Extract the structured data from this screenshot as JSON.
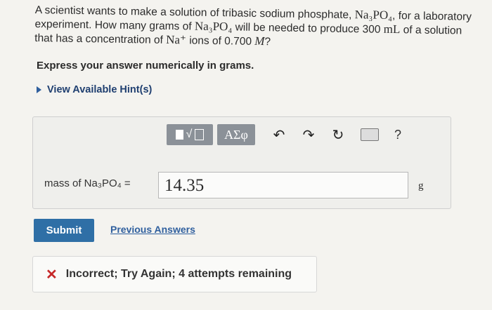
{
  "question": {
    "line1_a": "A scientist wants to make a solution of tribasic sodium phosphate, ",
    "line1_formula": "Na₃PO₄",
    "line1_b": ", for a laboratory",
    "line2_a": "experiment. How many grams of ",
    "line2_formula": "Na₃PO₄",
    "line2_b": " will be needed to produce 300 ",
    "line2_unit": "mL",
    "line2_c": " of a solution",
    "line3_a": "that has a concentration of ",
    "line3_ion": "Na⁺",
    "line3_b": " ions of 0.700 ",
    "line3_M": "M",
    "line3_c": "?"
  },
  "instruction": "Express your answer numerically in grams.",
  "hint_label": "View Available Hint(s)",
  "toolbar": {
    "greek_label": "ΑΣφ",
    "undo_symbol": "↶",
    "redo_symbol": "↷",
    "reset_symbol": "↻",
    "help_symbol": "?"
  },
  "answer": {
    "label": "mass of Na₃PO₄ =",
    "value": "14.35",
    "unit": "g"
  },
  "submit_label": "Submit",
  "previous_answers_label": "Previous Answers",
  "feedback": {
    "icon": "✕",
    "text": "Incorrect; Try Again; 4 attempts remaining"
  },
  "colors": {
    "accent": "#2f6fa6",
    "error": "#c62828",
    "toolbar_button": "#8b9198"
  }
}
